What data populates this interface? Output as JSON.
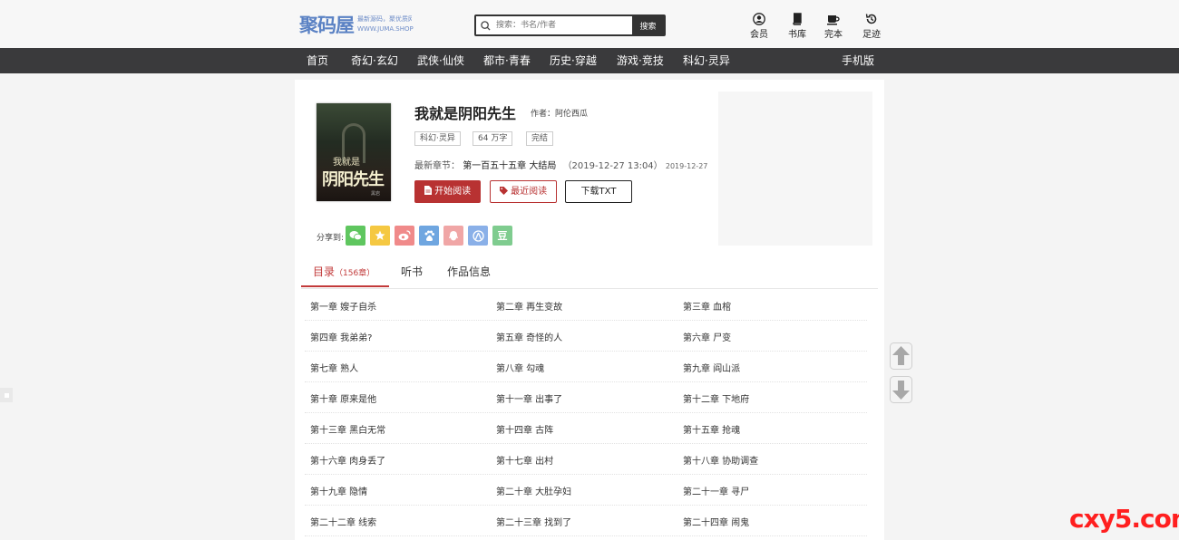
{
  "header": {
    "logo_main": "聚码屋",
    "logo_sub_1": "最新源码，聚优质网下载平台",
    "logo_sub_2": "WWW.JUMA.SHOP",
    "search_placeholder": "搜索：书名/作者",
    "search_button": "搜索",
    "nav": [
      {
        "label": "会员",
        "icon": "user-icon"
      },
      {
        "label": "书库",
        "icon": "book-icon"
      },
      {
        "label": "完本",
        "icon": "cup-icon"
      },
      {
        "label": "足迹",
        "icon": "history-icon"
      }
    ]
  },
  "navbar": {
    "items": [
      "首页",
      "奇幻·玄幻",
      "武侠·仙侠",
      "都市·青春",
      "历史·穿越",
      "游戏·竞技",
      "科幻·灵异"
    ],
    "mobile": "手机版"
  },
  "book": {
    "title": "我就是阴阳先生",
    "author_label": "作者：",
    "author": "阿伦西瓜",
    "cover_title_small": "我就是",
    "cover_title_big": "阴阳先生",
    "cover_publisher": "黑岩",
    "tags": [
      "科幻·灵异",
      "64 万字",
      "完结"
    ],
    "latest_label": "最新章节：",
    "latest_chapter": "第一百五十五章 大结局",
    "latest_time": "（2019-12-27 13:04）",
    "latest_date": "2019-12-27",
    "btn_start": "开始阅读",
    "btn_recent": "最近阅读",
    "btn_txt": "下载TXT"
  },
  "share": {
    "label": "分享到:",
    "items": [
      {
        "icon": "wechat-icon",
        "color": "#5fc65f",
        "glyph": "◉"
      },
      {
        "icon": "qzone-icon",
        "color": "#f5c842",
        "glyph": "★"
      },
      {
        "icon": "weibo-icon",
        "color": "#f08a8a",
        "glyph": "◎"
      },
      {
        "icon": "baidu-icon",
        "color": "#6fa6e0",
        "glyph": "✿"
      },
      {
        "icon": "qq-icon",
        "color": "#f0a6a6",
        "glyph": "♟"
      },
      {
        "icon": "renren-icon",
        "color": "#8ab0e8",
        "glyph": "人"
      },
      {
        "icon": "douban-icon",
        "color": "#7fcc8f",
        "glyph": "豆"
      }
    ]
  },
  "tabs": {
    "catalog": "目录",
    "catalog_count": "（156章）",
    "audio": "听书",
    "info": "作品信息"
  },
  "chapters": [
    [
      "第一章 嫂子自杀",
      "第二章 再生变故",
      "第三章 血棺"
    ],
    [
      "第四章 我弟弟?",
      "第五章 奇怪的人",
      "第六章 尸变"
    ],
    [
      "第七章 熟人",
      "第八章 勾魂",
      "第九章 阎山派"
    ],
    [
      "第十章 原来是他",
      "第十一章 出事了",
      "第十二章 下地府"
    ],
    [
      "第十三章 黑白无常",
      "第十四章 古阵",
      "第十五章 抢魂"
    ],
    [
      "第十六章 肉身丢了",
      "第十七章 出村",
      "第十八章 协助调查"
    ],
    [
      "第十九章 隐情",
      "第二十章 大肚孕妇",
      "第二十一章 寻尸"
    ],
    [
      "第二十二章 线索",
      "第二十三章 找到了",
      "第二十四章 闹鬼"
    ]
  ],
  "watermark": "cxy5.com",
  "colors": {
    "accent": "#c23a3a",
    "navbar": "#3a3a3c",
    "button_red": "#b83232"
  }
}
